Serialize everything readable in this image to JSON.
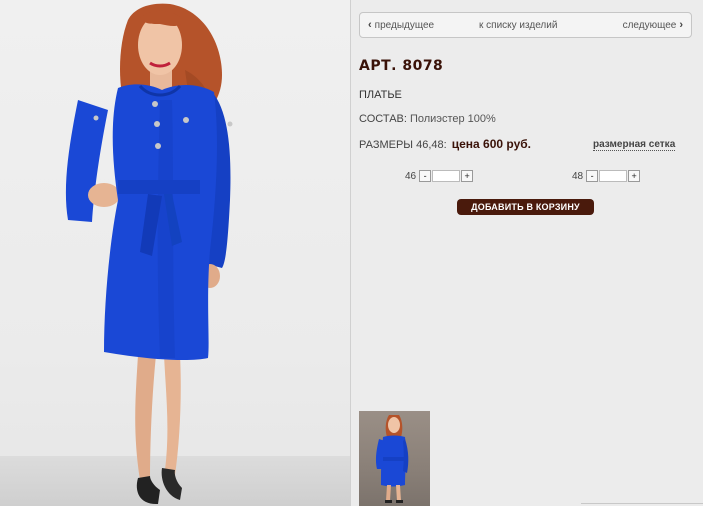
{
  "nav": {
    "prev_label": "предыдущее",
    "list_label": "к списку изделий",
    "next_label": "следующее"
  },
  "product": {
    "article": "АРТ. 8078",
    "type": "ПЛАТЬЕ",
    "composition_label": "СОСТАВ:",
    "composition_value": "Полиэстер 100%",
    "sizes_label": "РАЗМЕРЫ 46,48:",
    "price": "цена 600 руб.",
    "size_chart_label": "размерная сетка"
  },
  "quantity": [
    {
      "size": "46",
      "minus": "-",
      "plus": "+",
      "value": ""
    },
    {
      "size": "48",
      "minus": "-",
      "plus": "+",
      "value": ""
    }
  ],
  "cart": {
    "add_label": "ДОБАВИТЬ В КОРЗИНУ"
  },
  "colors": {
    "dress": "#1a48d6",
    "brand": "#4a1a0c",
    "hair": "#b5532a"
  }
}
